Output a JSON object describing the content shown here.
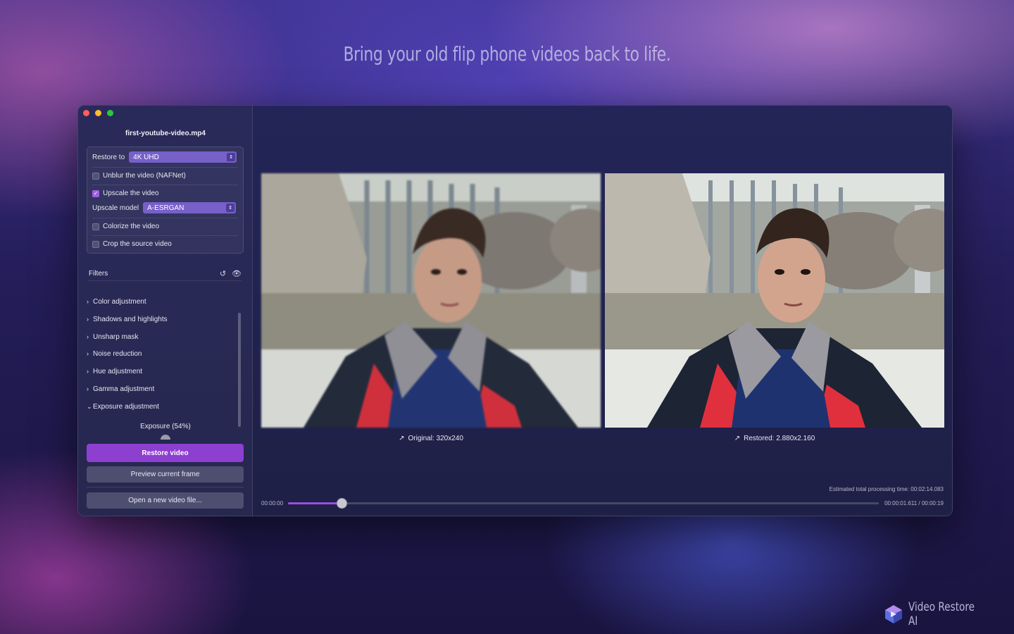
{
  "tagline": "Bring your old flip phone videos back to life.",
  "brand": {
    "name": "Video Restore AI",
    "icon": "hexagon-logo-icon"
  },
  "window": {
    "traffic_lights": {
      "close": "#ff5f57",
      "minimize": "#febc2e",
      "zoom": "#28c840"
    },
    "file_name": "first-youtube-video.mp4"
  },
  "options": {
    "restore_to_label": "Restore to",
    "restore_to_value": "4K UHD",
    "unblur": {
      "label": "Unblur the video (NAFNet)",
      "checked": false
    },
    "upscale": {
      "label": "Upscale the video",
      "checked": true
    },
    "upscale_model_label": "Upscale model",
    "upscale_model_value": "A-ESRGAN",
    "colorize": {
      "label": "Colorize the video",
      "checked": false
    },
    "crop": {
      "label": "Crop the source video",
      "checked": false
    }
  },
  "filters": {
    "title": "Filters",
    "items": [
      {
        "label": "Color adjustment",
        "expanded": false
      },
      {
        "label": "Shadows and highlights",
        "expanded": false
      },
      {
        "label": "Unsharp mask",
        "expanded": false
      },
      {
        "label": "Noise reduction",
        "expanded": false
      },
      {
        "label": "Hue adjustment",
        "expanded": false
      },
      {
        "label": "Gamma adjustment",
        "expanded": false
      },
      {
        "label": "Exposure adjustment",
        "expanded": true
      }
    ],
    "exposure_label": "Exposure (54%)",
    "exposure_value": 0.54
  },
  "buttons": {
    "restore": "Restore video",
    "preview": "Preview current frame",
    "open": "Open a new video file..."
  },
  "preview": {
    "original_caption": "Original: 320x240",
    "restored_caption": "Restored: 2.880x2.160"
  },
  "timeline": {
    "estimate": "Estimated total processing time: 00:02:14.083",
    "start": "00:00:00",
    "position": "00:00:01.611 / 00:00:19",
    "progress": 0.0906
  },
  "colors": {
    "accent": "#8d3fd0",
    "select": "#7760c8"
  }
}
